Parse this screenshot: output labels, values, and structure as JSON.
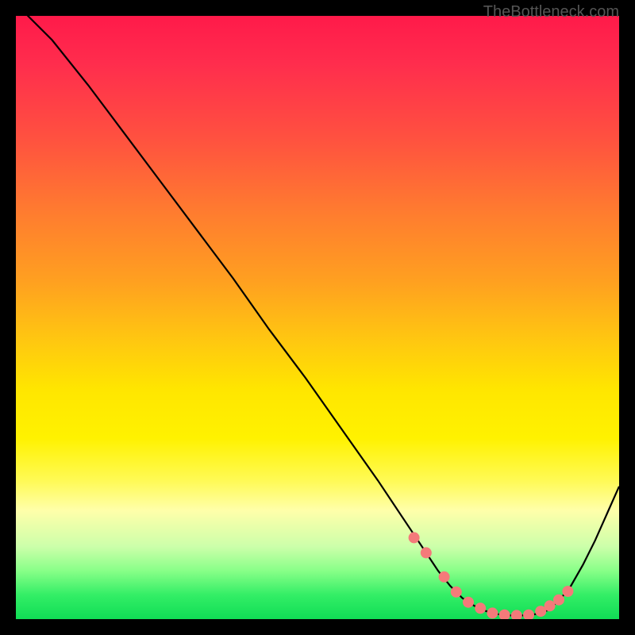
{
  "watermark": "TheBottleneck.com",
  "chart_data": {
    "type": "line",
    "title": "",
    "xlabel": "",
    "ylabel": "",
    "xlim": [
      0,
      100
    ],
    "ylim": [
      0,
      100
    ],
    "series": [
      {
        "name": "curve",
        "x": [
          0,
          6,
          12,
          18,
          24,
          30,
          36,
          42,
          48,
          54,
          60,
          64,
          68,
          70,
          72,
          74,
          76,
          78,
          80,
          82,
          84,
          86,
          88,
          90,
          92,
          94,
          96,
          98,
          100
        ],
        "y": [
          102,
          96,
          88.5,
          80.5,
          72.5,
          64.5,
          56.5,
          48,
          40,
          31.5,
          23,
          17,
          11,
          8,
          5.5,
          3.5,
          2.2,
          1.3,
          0.8,
          0.6,
          0.6,
          0.8,
          1.4,
          3,
          5.5,
          9,
          13,
          17.5,
          22
        ]
      }
    ],
    "markers": {
      "x": [
        66,
        68,
        71,
        73,
        75,
        77,
        79,
        81,
        83,
        85,
        87,
        88.5,
        90,
        91.5
      ],
      "y": [
        13.5,
        11,
        7,
        4.5,
        2.8,
        1.8,
        1.0,
        0.7,
        0.6,
        0.7,
        1.3,
        2.2,
        3.2,
        4.6
      ]
    },
    "background_gradient": {
      "top": "#ff1a4a",
      "mid": "#ffe600",
      "bottom": "#10dd55"
    }
  }
}
